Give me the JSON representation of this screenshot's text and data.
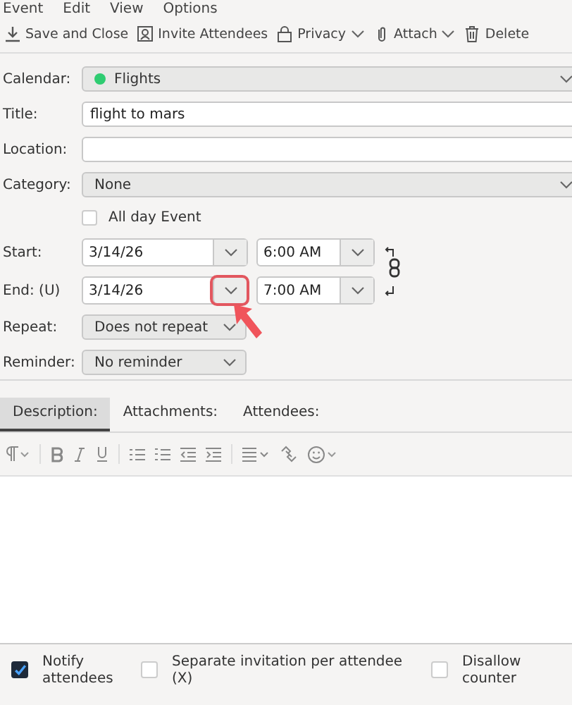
{
  "menu": [
    "Event",
    "Edit",
    "View",
    "Options"
  ],
  "toolbar": [
    {
      "kind": "save",
      "label": "Save and Close",
      "dropdown": false
    },
    {
      "kind": "invite",
      "label": "Invite Attendees",
      "dropdown": false
    },
    {
      "kind": "privacy",
      "label": "Privacy",
      "dropdown": true
    },
    {
      "kind": "attach",
      "label": "Attach",
      "dropdown": true
    },
    {
      "kind": "delete",
      "label": "Delete",
      "dropdown": false
    }
  ],
  "calendar": {
    "label": "Calendar:",
    "value": "Flights",
    "color": "#2ecc71"
  },
  "title": {
    "label": "Title:",
    "value": "flight to mars"
  },
  "location": {
    "label": "Location:"
  },
  "category": {
    "label": "Category:",
    "value": "None"
  },
  "all_day": {
    "label": "All day Event",
    "checked": false
  },
  "start": {
    "label": "Start:",
    "date": "3/14/26",
    "time": "6:00 AM"
  },
  "end": {
    "label": "End: (U)",
    "date": "3/14/26",
    "time": "7:00 AM",
    "highlighted": true
  },
  "repeat": {
    "label": "Repeat:",
    "value": "Does not repeat"
  },
  "reminder": {
    "label": "Reminder:",
    "value": "No reminder"
  },
  "tabs": [
    {
      "label": "Description:",
      "selected": true
    },
    {
      "label": "Attachments:",
      "selected": false
    },
    {
      "label": "Attendees:",
      "selected": false
    }
  ],
  "options": [
    {
      "label": "Notify attendees",
      "checked": true
    },
    {
      "label": "Separate invitation per attendee (X)",
      "checked": false
    },
    {
      "label": "Disallow counter",
      "checked": false
    }
  ]
}
